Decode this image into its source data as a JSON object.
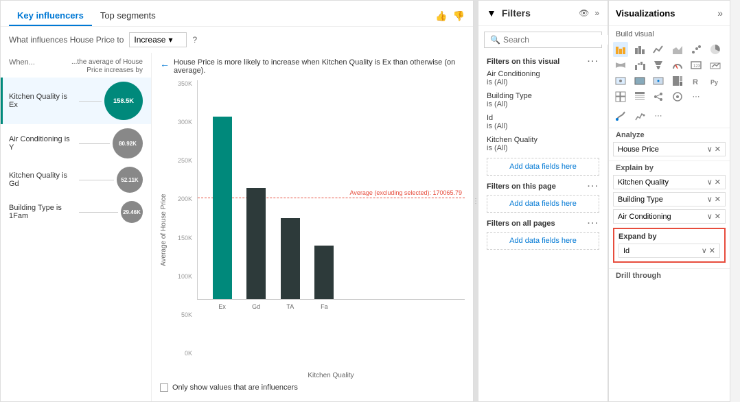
{
  "tabs": {
    "items": [
      {
        "id": "key-influencers",
        "label": "Key influencers",
        "active": true
      },
      {
        "id": "top-segments",
        "label": "Top segments",
        "active": false
      }
    ]
  },
  "filter_row": {
    "question": "What influences House Price to",
    "dropdown_value": "Increase",
    "help": "?"
  },
  "col_headers": {
    "left": "When...",
    "right": "...the average of House Price increases by"
  },
  "influencers": [
    {
      "label": "Kitchen Quality is Ex",
      "value": "158.5K",
      "bubble_size": 56,
      "type": "teal",
      "selected": true
    },
    {
      "label": "Air Conditioning is Y",
      "value": "80.92K",
      "bubble_size": 44,
      "type": "gray",
      "selected": false
    },
    {
      "label": "Kitchen Quality is Gd",
      "value": "52.11K",
      "bubble_size": 38,
      "type": "gray",
      "selected": false
    },
    {
      "label": "Building Type is 1Fam",
      "value": "29.46K",
      "bubble_size": 32,
      "type": "gray",
      "selected": false
    }
  ],
  "chart": {
    "description": "House Price is more likely to increase when Kitchen Quality is Ex than otherwise (on average).",
    "y_label": "Average of House Price",
    "x_label": "Kitchen Quality",
    "avg_line_label": "Average (excluding selected): 170065.79",
    "y_ticks": [
      "0K",
      "50K",
      "100K",
      "150K",
      "200K",
      "250K",
      "300K",
      "350K"
    ],
    "bars": [
      {
        "label": "Ex",
        "height_pct": 95,
        "color": "#00897B"
      },
      {
        "label": "Gd",
        "height_pct": 58,
        "color": "#2d3a3a"
      },
      {
        "label": "TA",
        "height_pct": 42,
        "color": "#2d3a3a"
      },
      {
        "label": "Fa",
        "height_pct": 28,
        "color": "#2d3a3a"
      }
    ],
    "avg_line_pct": 46,
    "show_influencers_label": "Only show values that are influencers"
  },
  "filters": {
    "title": "Filters",
    "search_placeholder": "Search",
    "sections": [
      {
        "id": "on-visual",
        "title": "Filters on this visual",
        "items": [
          {
            "name": "Air Conditioning",
            "sub": "is (All)"
          },
          {
            "name": "Building Type",
            "sub": "is (All)"
          },
          {
            "name": "Id",
            "sub": "is (All)"
          },
          {
            "name": "Kitchen Quality",
            "sub": "is (All)"
          }
        ],
        "add_data_label": "Add data fields here"
      },
      {
        "id": "on-page",
        "title": "Filters on this page",
        "items": [],
        "add_data_label": "Add data fields here"
      },
      {
        "id": "all-pages",
        "title": "Filters on all pages",
        "items": [],
        "add_data_label": "Add data fields here"
      }
    ]
  },
  "visualizations": {
    "title": "Visualizations",
    "build_visual_label": "Build visual",
    "analyze_label": "Analyze",
    "analyze_field": "House Price",
    "explain_by_label": "Explain by",
    "explain_fields": [
      {
        "name": "Kitchen Quality"
      },
      {
        "name": "Building Type"
      },
      {
        "name": "Air Conditioning"
      }
    ],
    "expand_by_label": "Expand by",
    "expand_field": {
      "name": "Id"
    },
    "drill_through_label": "Drill through"
  }
}
